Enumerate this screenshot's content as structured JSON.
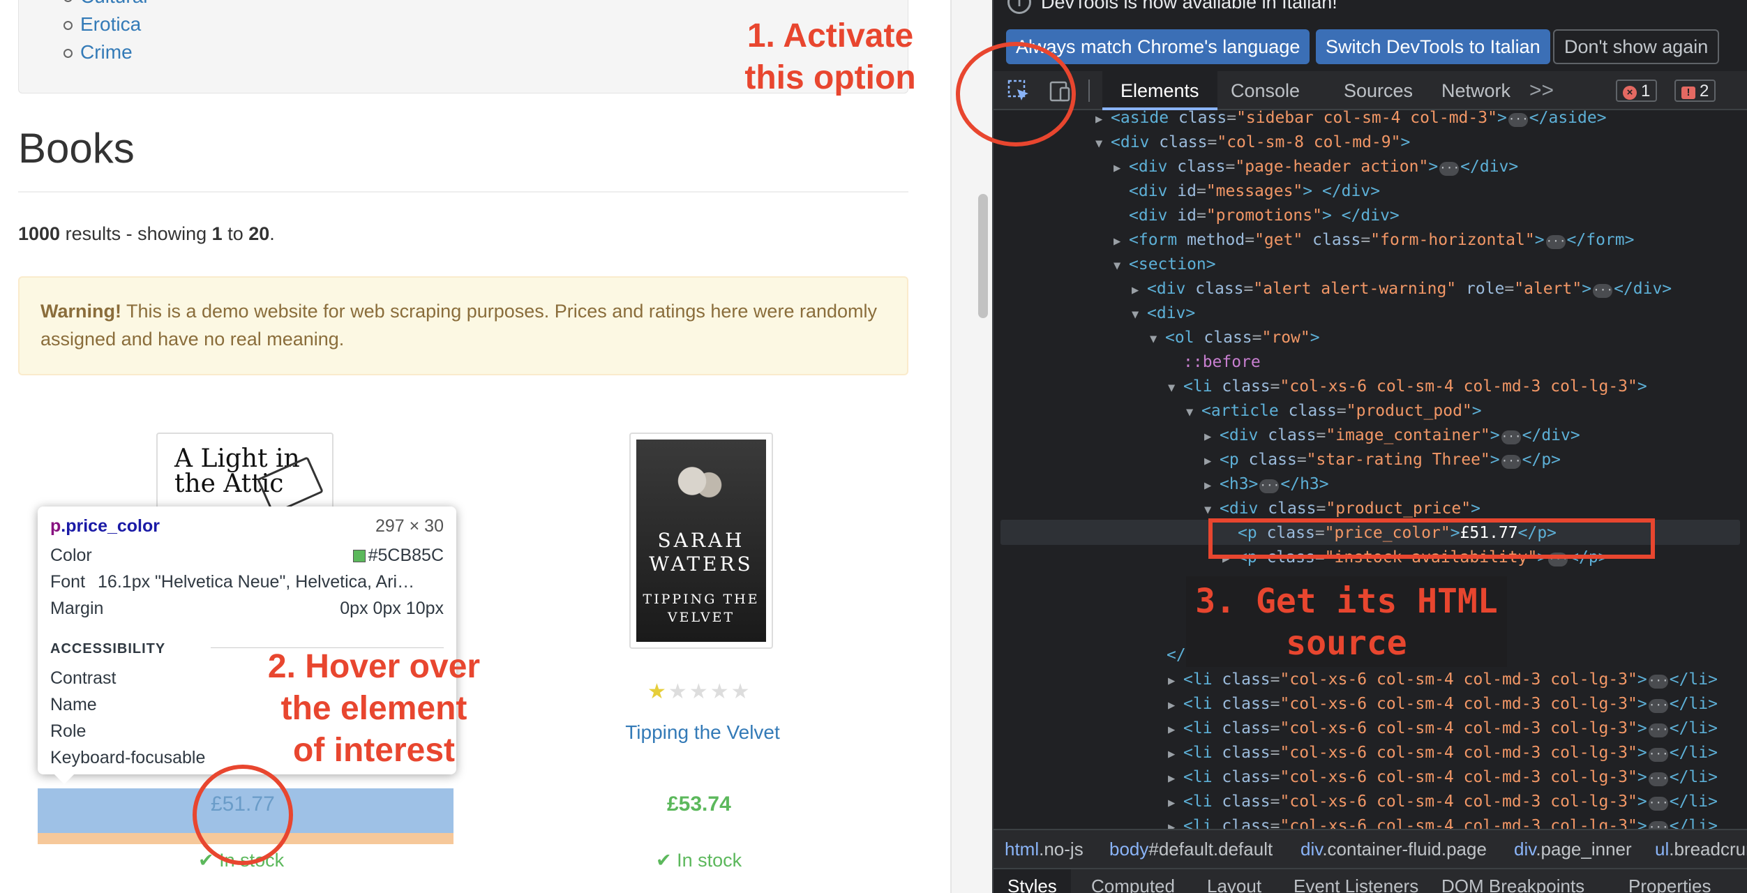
{
  "page": {
    "categories": [
      "Cultural",
      "Erotica",
      "Crime"
    ],
    "heading": "Books",
    "results": {
      "total": "1000",
      "mid": " results - showing ",
      "from": "1",
      "to_word": " to ",
      "to": "20",
      "end": "."
    },
    "warning": {
      "bold": "Warning!",
      "text": " This is a demo website for web scraping purposes. Prices and ratings here were randomly assigned and have no real meaning."
    },
    "book1": {
      "cover_text": "A Light in the Attic",
      "price": "£51.77",
      "stock": "In stock"
    },
    "book2": {
      "cover_author": "SARAH WATERS",
      "cover_title": "TIPPING THE VELVET",
      "rating": 1,
      "rating_max": 5,
      "title": "Tipping the Velvet",
      "price": "£53.74",
      "stock": "In stock"
    },
    "tooltip": {
      "tag": "p",
      "class": ".price_color",
      "size": "297 × 30",
      "color_label": "Color",
      "color_value": "#5CB85C",
      "font_label": "Font",
      "font_value": "16.1px \"Helvetica Neue\", Helvetica, Ari…",
      "margin_label": "Margin",
      "margin_value": "0px 0px 10px",
      "accessibility": "ACCESSIBILITY",
      "contrast": "Contrast",
      "name": "Name",
      "role": "Role",
      "focusable": "Keyboard-focusable"
    }
  },
  "annotations": {
    "step1": [
      "1. Activate",
      "this option"
    ],
    "step2": [
      "2. Hover over",
      "the element",
      "of interest"
    ],
    "step3": [
      "3. Get its  HTML",
      "source"
    ],
    "color": "#e8462f"
  },
  "devtools": {
    "info_text": "DevTools is now available in Italian!",
    "buttons": {
      "match": "Always match Chrome's language",
      "switch": "Switch DevTools to Italian",
      "dismiss": "Don't show again"
    },
    "tabs": [
      "Elements",
      "Console",
      "Sources",
      "Network"
    ],
    "more": ">>",
    "errors": "1",
    "issues": "2",
    "breadcrumbs": [
      {
        "tag": "html",
        "rest": ".no-js"
      },
      {
        "tag": "body",
        "rest": "#default.default"
      },
      {
        "tag": "div",
        "rest": ".container-fluid.page"
      },
      {
        "tag": "div",
        "rest": ".page_inner"
      },
      {
        "tag": "ul",
        "rest": ".breadcrumb"
      }
    ],
    "subtabs": [
      "Styles",
      "Computed",
      "Layout",
      "Event Listeners",
      "DOM Breakpoints",
      "Properties"
    ]
  }
}
